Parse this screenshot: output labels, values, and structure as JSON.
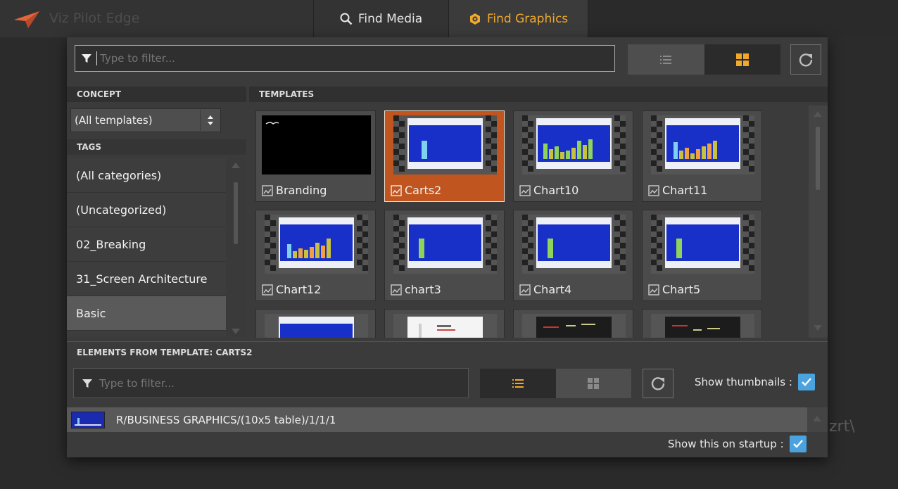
{
  "app": {
    "name": "Viz Pilot Edge"
  },
  "tabs": [
    {
      "label": "Find Media",
      "icon": "search-icon"
    },
    {
      "label": "Find Graphics",
      "icon": "graphics-icon",
      "active": true
    }
  ],
  "colors": {
    "accent": "#f0a92b",
    "selected": "#c0551f",
    "checkbox": "#4aa3df",
    "background": "#2b2b2b"
  },
  "filter": {
    "placeholder": "Type to filter..."
  },
  "view": {
    "list_icon": "list-view-icon",
    "grid_icon": "grid-view-icon",
    "active": "grid"
  },
  "concept": {
    "header": "CONCEPT",
    "selected": "(All templates)"
  },
  "tags": {
    "header": "TAGS",
    "items": [
      "(All categories)",
      "(Uncategorized)",
      "02_Breaking",
      "31_Screen Architecture",
      "Basic"
    ],
    "selected_index": 4
  },
  "templates": {
    "header": "TEMPLATES",
    "items": [
      {
        "name": "Branding"
      },
      {
        "name": "Carts2"
      },
      {
        "name": "Chart10"
      },
      {
        "name": "Chart11"
      },
      {
        "name": "Chart12"
      },
      {
        "name": "chart3"
      },
      {
        "name": "Chart4"
      },
      {
        "name": "Chart5"
      },
      {
        "name": ""
      },
      {
        "name": ""
      },
      {
        "name": ""
      },
      {
        "name": ""
      }
    ],
    "selected_index": 1
  },
  "elements": {
    "header": "ELEMENTS FROM TEMPLATE: CARTS2",
    "filter_placeholder": "Type to filter...",
    "show_thumbnails_label": "Show thumbnails :",
    "show_thumbnails": true,
    "view_active": "list",
    "items": [
      {
        "path": "R/BUSINESS GRAPHICS/(10x5 table)/1/1/1"
      }
    ]
  },
  "footer": {
    "show_on_startup_label": "Show this on startup :",
    "show_on_startup": true
  },
  "watermark": "zrt\\"
}
